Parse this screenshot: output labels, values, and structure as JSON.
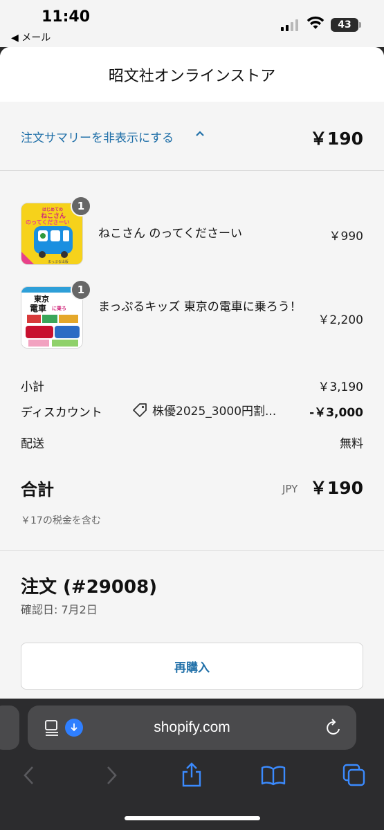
{
  "status_bar": {
    "time": "11:40",
    "back_app": "◀ メール",
    "battery": "43"
  },
  "store": {
    "name": "昭文社オンラインストア"
  },
  "summary": {
    "toggle_label": "注文サマリーを非表示にする",
    "total": "￥190"
  },
  "items": [
    {
      "qty": "1",
      "name": "ねこさん のってくださーい",
      "price": "￥990"
    },
    {
      "qty": "1",
      "name": "まっぷるキッズ 東京の電車に乗ろう！",
      "price": "￥2,200"
    }
  ],
  "thumbs": {
    "neko": {
      "top": "はじめての",
      "title": "ねこさん",
      "sub": "のってくださーい",
      "pub": "まっぷる出版"
    },
    "densha": {
      "title1": "東京",
      "title2": "電車",
      "suffix": "に乗ろ"
    }
  },
  "totals": {
    "subtotal_label": "小計",
    "subtotal": "￥3,190",
    "discount_label": "ディスカウント",
    "discount_code": "株優2025_3000円割...",
    "discount": "-￥3,000",
    "shipping_label": "配送",
    "shipping": "無料",
    "total_label": "合計",
    "currency": "JPY",
    "total": "￥190",
    "tax_note": "￥17の税金を含む"
  },
  "order": {
    "title": "注文 (#29008)",
    "date": "確認日: 7月2日",
    "reorder_label": "再購入"
  },
  "browser": {
    "url": "shopify.com"
  },
  "colors": {
    "accent": "#1f6fa8",
    "sheet_bg": "#f5f5f5",
    "chrome_bg": "#2c2c2e",
    "browser_icon": "#3b8bff"
  }
}
